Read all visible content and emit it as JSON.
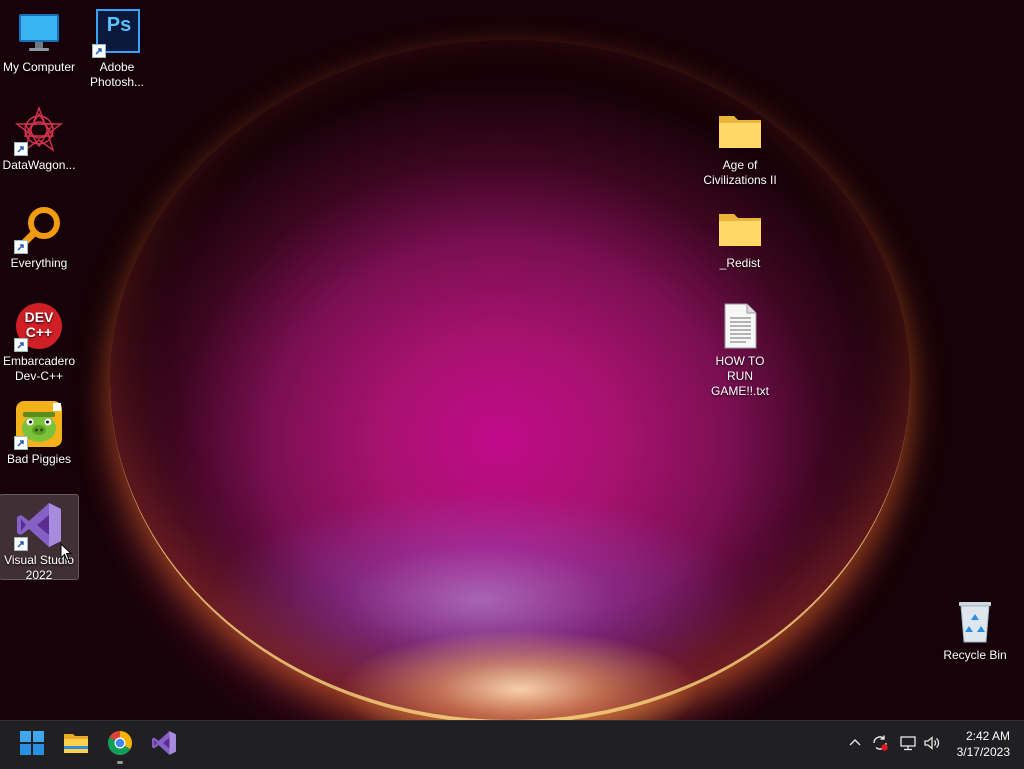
{
  "desktop": {
    "icons": [
      {
        "label": "My Computer",
        "icon": "monitor-icon"
      },
      {
        "label": "Adobe Photosh...",
        "icon": "photoshop-icon",
        "glyph_text": "Ps"
      },
      {
        "label": "DataWagon...",
        "icon": "datawagon-icon"
      },
      {
        "label": "Everything",
        "icon": "magnifier-icon"
      },
      {
        "label": "Embarcadero Dev-C++",
        "icon": "devcpp-icon",
        "glyph_text": "DEV C++"
      },
      {
        "label": "Bad Piggies",
        "icon": "bad-piggies-icon"
      },
      {
        "label": "Visual Studio 2022",
        "icon": "visual-studio-icon"
      },
      {
        "label": "Age of Civilizations II",
        "icon": "folder-icon"
      },
      {
        "label": "_Redist",
        "icon": "folder-icon"
      },
      {
        "label": "HOW TO RUN GAME!!.txt",
        "icon": "text-file-icon"
      },
      {
        "label": "Recycle Bin",
        "icon": "recycle-bin-icon"
      }
    ],
    "wallpaper_colors": {
      "core": "#c10a8a",
      "rim": "#ffd278",
      "edge": "#0a0107"
    }
  },
  "taskbar": {
    "apps": [
      {
        "name": "Start",
        "icon": "windows-start-icon"
      },
      {
        "name": "File Explorer",
        "icon": "file-explorer-icon"
      },
      {
        "name": "Google Chrome",
        "icon": "chrome-icon",
        "running": true
      },
      {
        "name": "Visual Studio 2022",
        "icon": "visual-studio-icon"
      }
    ],
    "tray": [
      {
        "name": "show hidden icons",
        "icon": "chevron-up-icon"
      },
      {
        "name": "sync",
        "icon": "sync-error-icon"
      },
      {
        "name": "network",
        "icon": "network-icon"
      },
      {
        "name": "volume",
        "icon": "volume-icon"
      }
    ],
    "clock": {
      "time": "2:42 AM",
      "date": "3/17/2023"
    }
  }
}
